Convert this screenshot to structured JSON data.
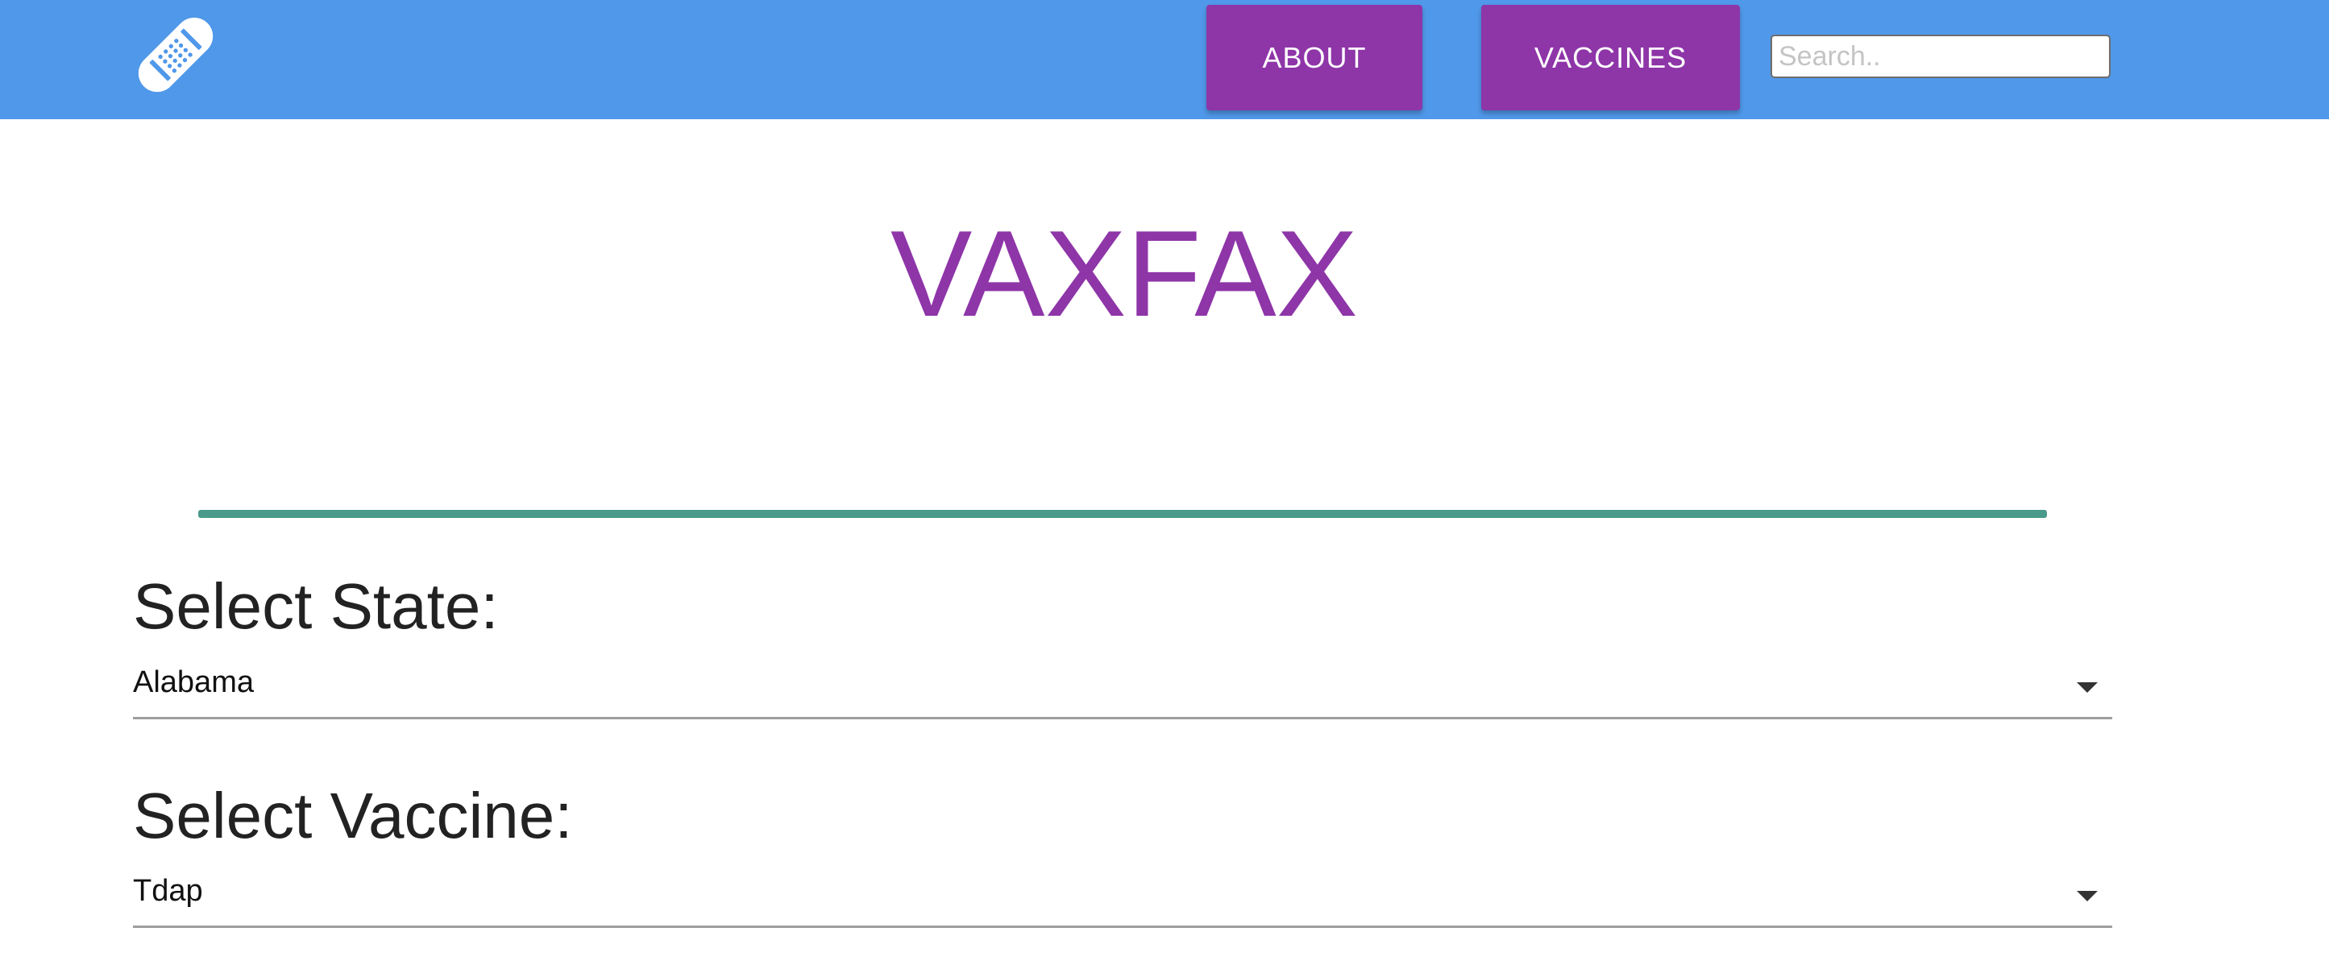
{
  "navbar": {
    "logo_icon": "bandage-icon",
    "background_color": "#5098E9",
    "about_label": "ABOUT",
    "vaccines_label": "VACCINES",
    "button_color": "#8E35A8",
    "search": {
      "placeholder": "Search..",
      "value": ""
    }
  },
  "main": {
    "title": "VAXFAX",
    "title_color": "#8E35A8",
    "divider_color": "#4A9A8C",
    "state_field": {
      "label": "Select State:",
      "selected": "Alabama"
    },
    "vaccine_field": {
      "label": "Select Vaccine:",
      "selected": "Tdap"
    }
  }
}
